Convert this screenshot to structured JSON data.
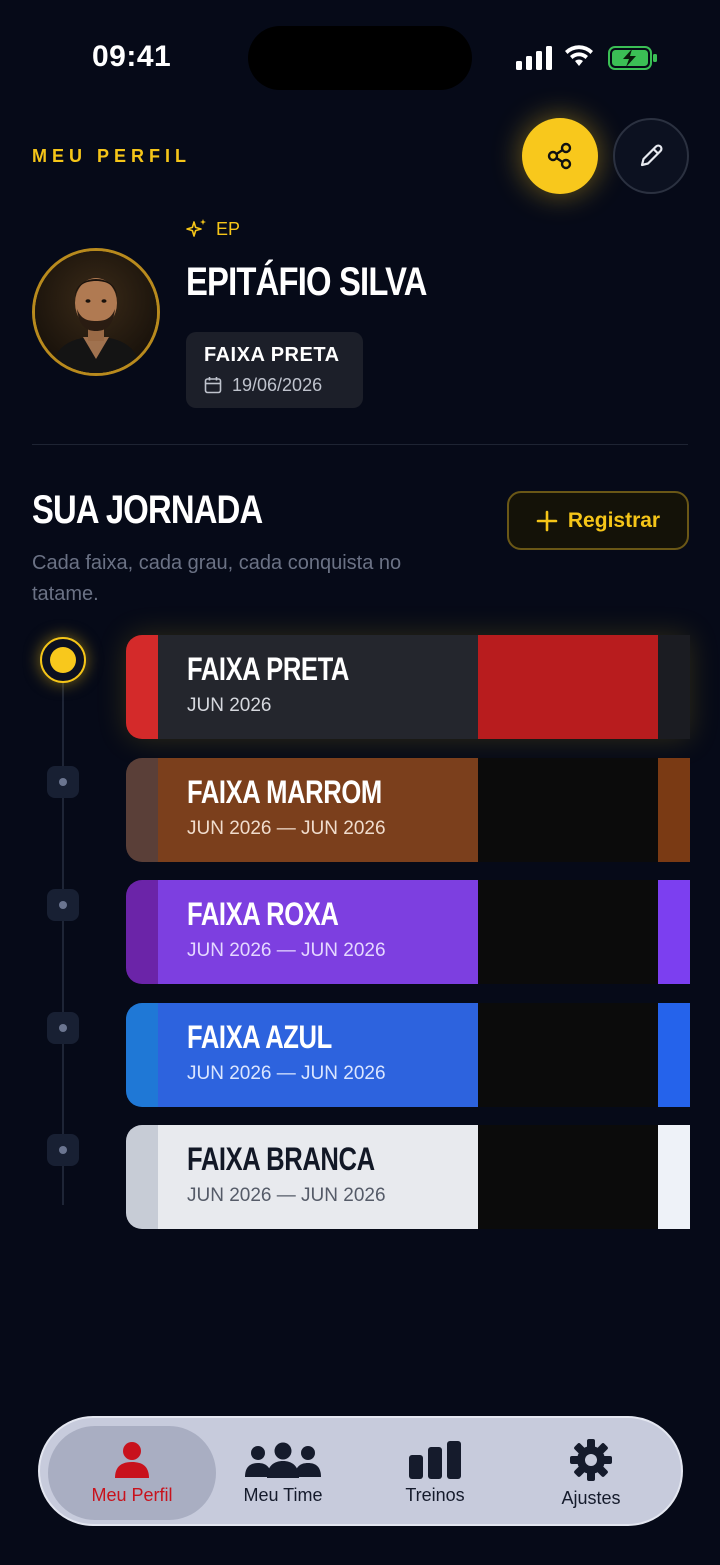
{
  "status_bar": {
    "time": "09:41"
  },
  "header": {
    "section_label": "MEU PERFIL"
  },
  "profile": {
    "initials": "EP",
    "name": "EPITÁFIO SILVA",
    "current_belt": "FAIXA PRETA",
    "belt_date": "19/06/2026"
  },
  "journey": {
    "title": "SUA JORNADA",
    "subtitle": "Cada faixa, cada grau, cada conquista no tatame.",
    "register_label": "Registrar",
    "belts": [
      {
        "title": "FAIXA PRETA",
        "date": "JUN 2026",
        "colors": {
          "stripe": "#d42a2a",
          "body": "#24262d",
          "bar": "#b81c1e",
          "tail": "#1b1c22",
          "text": "#ffffff",
          "date": "#d6d8de"
        }
      },
      {
        "title": "FAIXA MARROM",
        "date": "JUN 2026 — JUN 2026",
        "colors": {
          "stripe": "#5a3f38",
          "body": "#7b3f1c",
          "bar": "#0b0b0b",
          "tail": "#7a3a14",
          "text": "#ffffff",
          "date": "#f0dccd"
        }
      },
      {
        "title": "FAIXA ROXA",
        "date": "JUN 2026 — JUN 2026",
        "colors": {
          "stripe": "#6b24a8",
          "body": "#7d3fe0",
          "bar": "#0b0b0b",
          "tail": "#7c3ff0",
          "text": "#ffffff",
          "date": "#e5d8ff"
        }
      },
      {
        "title": "FAIXA AZUL",
        "date": "JUN 2026 — JUN 2026",
        "colors": {
          "stripe": "#1f78d6",
          "body": "#2d63de",
          "bar": "#0b0b0b",
          "tail": "#2563eb",
          "text": "#ffffff",
          "date": "#dbe6ff"
        }
      },
      {
        "title": "FAIXA BRANCA",
        "date": "JUN 2026 — JUN 2026",
        "colors": {
          "stripe": "#c7ccd6",
          "body": "#e8eaee",
          "bar": "#0b0b0b",
          "tail": "#eef2f8",
          "text": "#121826",
          "date": "#555b68"
        }
      }
    ]
  },
  "tabbar": {
    "tabs": [
      {
        "label": "Meu Perfil",
        "icon": "person-icon",
        "active": true
      },
      {
        "label": "Meu Time",
        "icon": "team-icon",
        "active": false
      },
      {
        "label": "Treinos",
        "icon": "bar-chart-icon",
        "active": false
      },
      {
        "label": "Ajustes",
        "icon": "gear-icon",
        "active": false
      }
    ]
  }
}
